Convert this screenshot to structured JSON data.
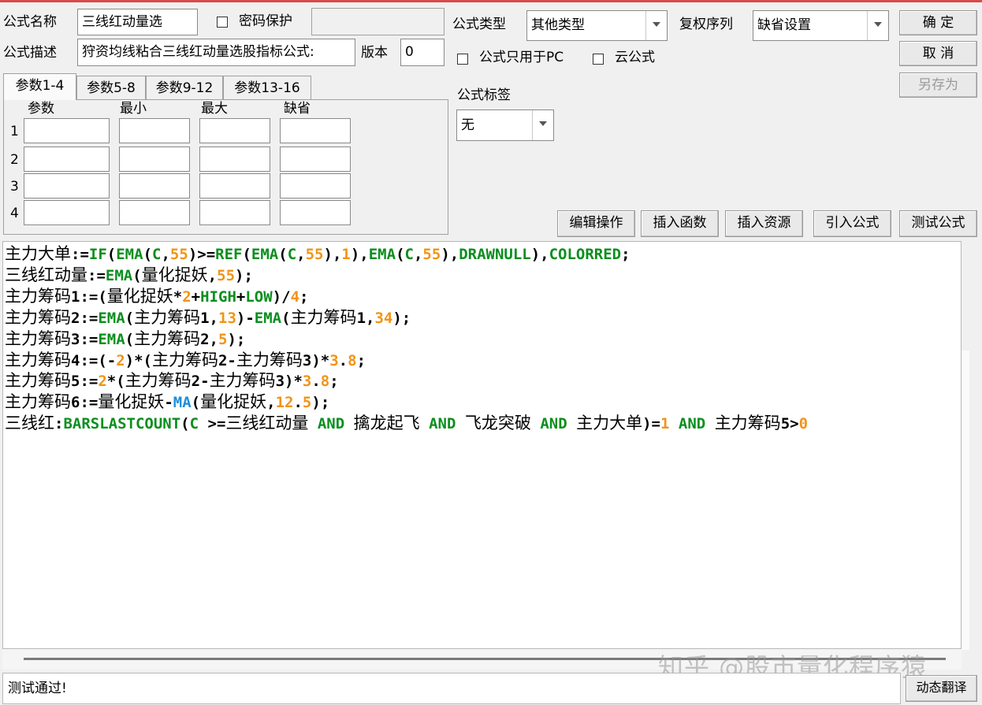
{
  "header": {
    "name_label": "公式名称",
    "name_value": "三线红动量选",
    "password_label": "密码保护",
    "desc_label": "公式描述",
    "desc_value": "狩资均线粘合三线红动量选股指标公式:",
    "version_label": "版本",
    "version_value": "0",
    "type_label": "公式类型",
    "type_value": "其他类型",
    "rights_label": "复权序列",
    "rights_value": "缺省设置",
    "pc_only_label": "公式只用于PC",
    "cloud_label": "云公式",
    "tag_label": "公式标签",
    "tag_value": "无"
  },
  "buttons": {
    "confirm": "确  定",
    "cancel": "取  消",
    "save_as": "另存为",
    "edit_ops": "编辑操作",
    "insert_func": "插入函数",
    "insert_res": "插入资源",
    "import_formula": "引入公式",
    "test_formula": "测试公式",
    "dynamic_translate": "动态翻译"
  },
  "params": {
    "tabs": [
      "参数1-4",
      "参数5-8",
      "参数9-12",
      "参数13-16"
    ],
    "columns": [
      "参数",
      "最小",
      "最大",
      "缺省"
    ],
    "rows": [
      "1",
      "2",
      "3",
      "4"
    ]
  },
  "code_lines": [
    "主力大单:=IF(EMA(C,55)>=REF(EMA(C,55),1),EMA(C,55),DRAWNULL),COLORRED;",
    "三线红动量:=EMA(量化捉妖,55);",
    "主力筹码1:=(量化捉妖*2+HIGH+LOW)/4;",
    "主力筹码2:=EMA(主力筹码1,13)-EMA(主力筹码1,34);",
    "主力筹码3:=EMA(主力筹码2,5);",
    "主力筹码4:=(-2)*(主力筹码2-主力筹码3)*3.8;",
    "主力筹码5:=2*(主力筹码2-主力筹码3)*3.8;",
    "主力筹码6:=量化捉妖-MA(量化捉妖,12.5);",
    "三线红:BARSLASTCOUNT(C >=三线红动量 AND 擒龙起飞 AND 飞龙突破 AND 主力大单)=1 AND 主力筹码5>0"
  ],
  "status_text": "测试通过!",
  "watermark": "知乎 @股市量化程序猿",
  "colors": {
    "keyword": "#0a8f1e",
    "number": "#f29417",
    "ma_function": "#1e8fd8"
  }
}
